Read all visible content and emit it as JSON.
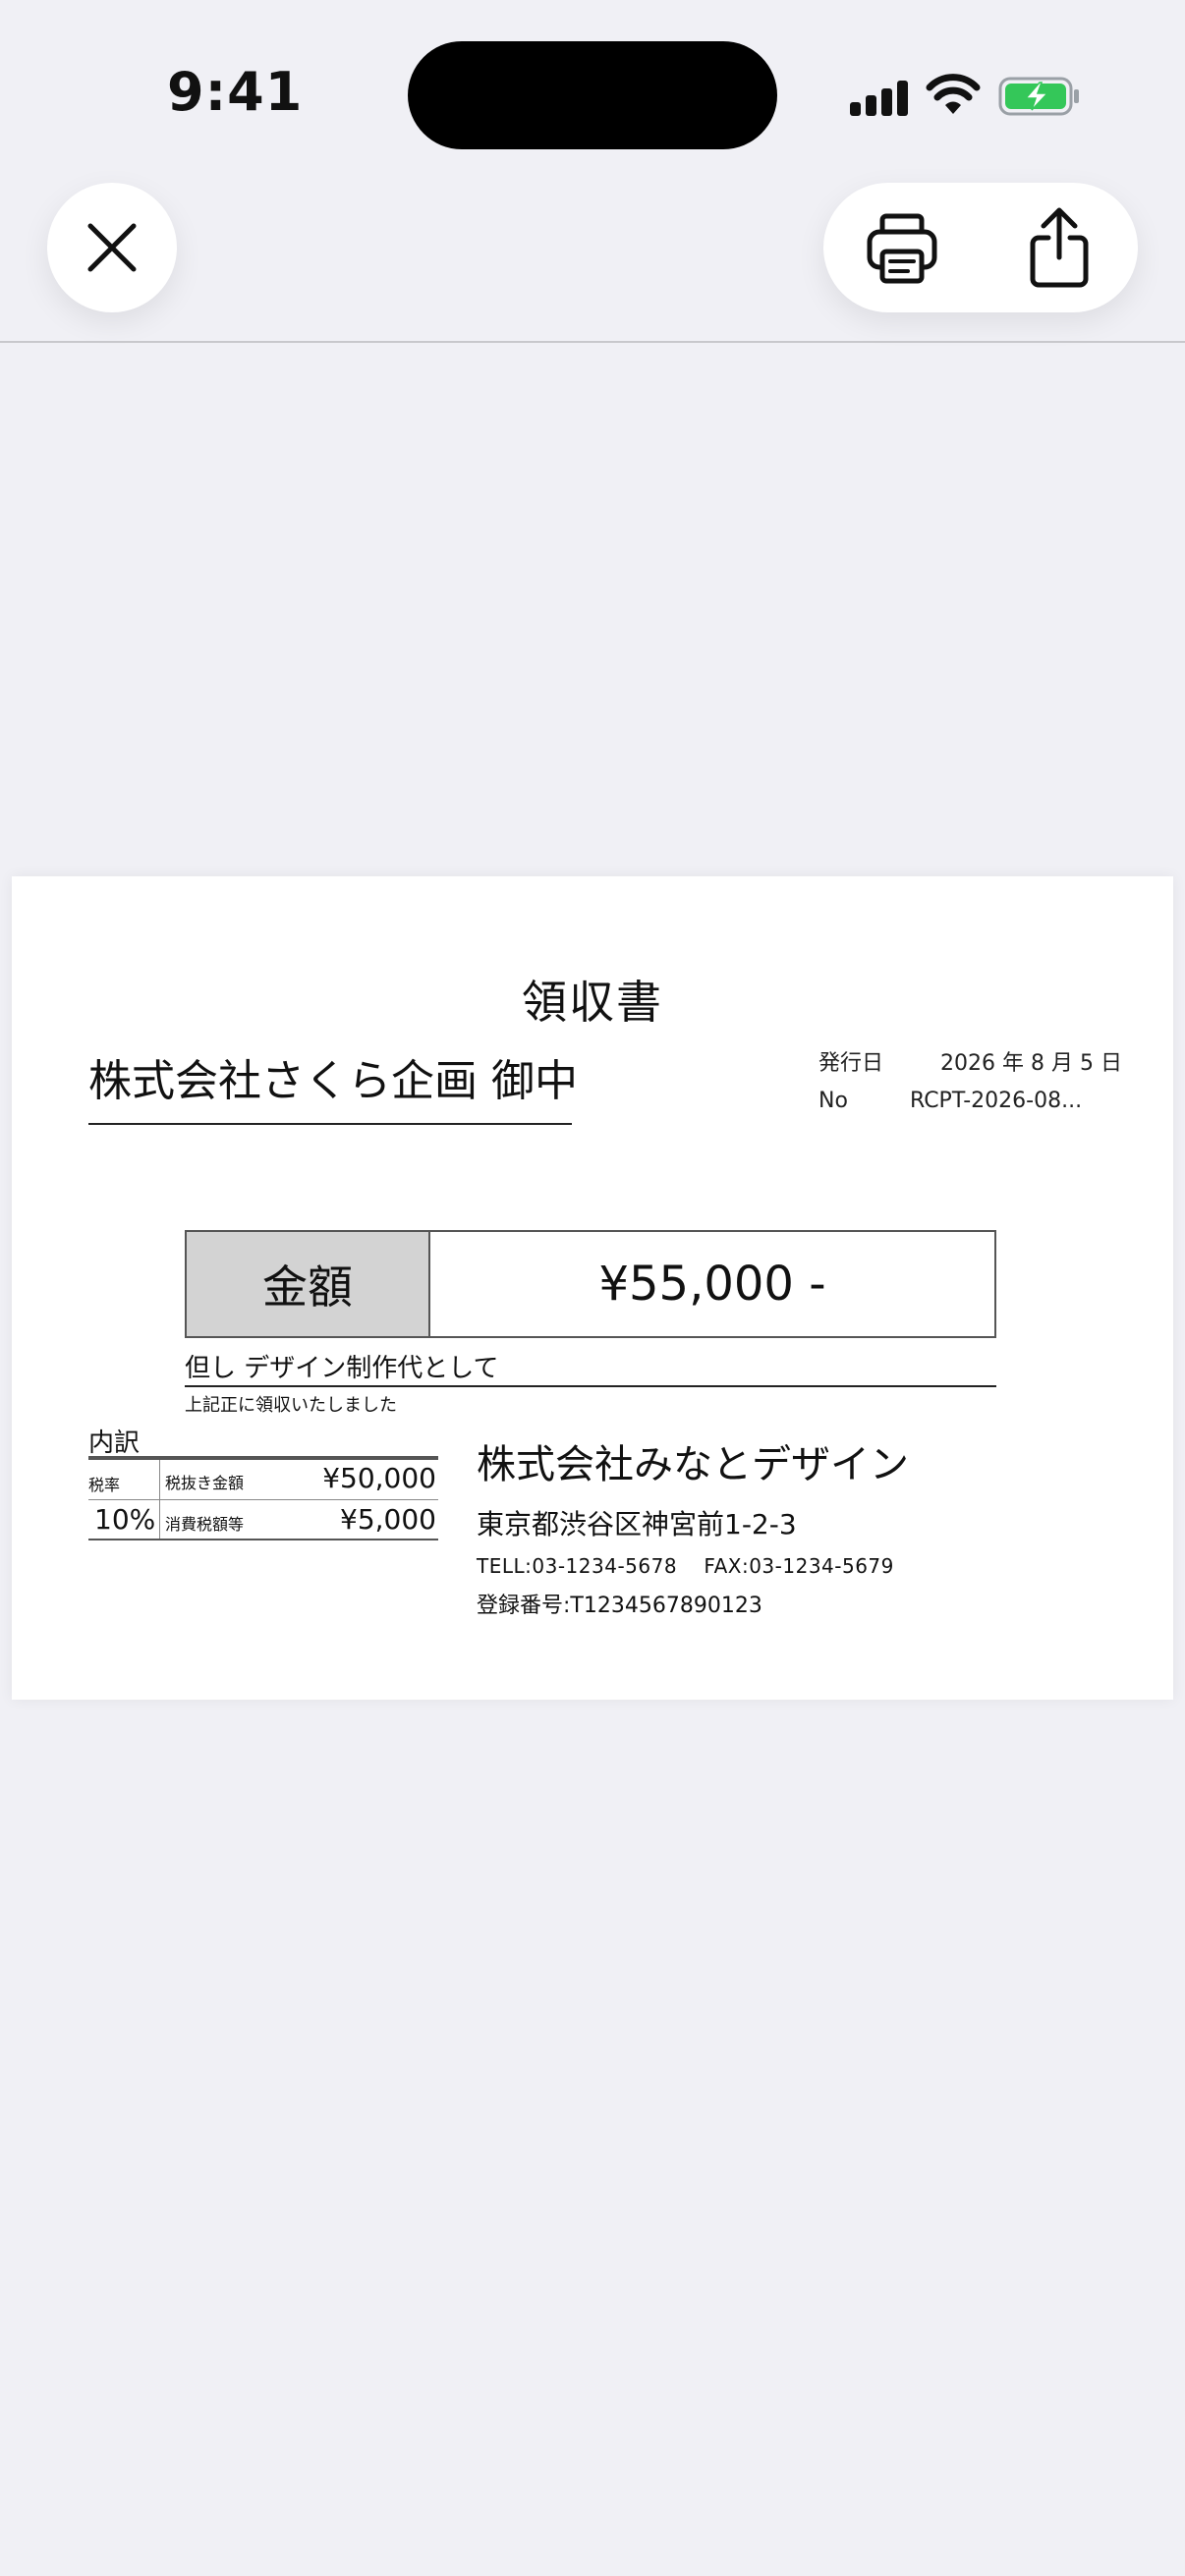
{
  "status_bar": {
    "time": "9:41"
  },
  "toolbar": {
    "close_icon": "close-icon",
    "print_icon": "print-icon",
    "share_icon": "share-icon"
  },
  "receipt": {
    "title": "領収書",
    "recipient": "株式会社さくら企画 御中",
    "issue_date_label": "発行日",
    "issue_date": "2026 年 8 月 5 日",
    "number_label": "No",
    "number": "RCPT-2026-08...",
    "amount_label": "金額",
    "amount": "¥55,000 -",
    "memo": "但し デザイン制作代として",
    "note": "上記正に領収いたしました",
    "breakdown": {
      "title": "内訳",
      "tax_rate_label": "税率",
      "tax_rate": "10%",
      "subtotal_label": "税抜き金額",
      "subtotal": "¥50,000",
      "tax_label": "消費税額等",
      "tax": "¥5,000"
    },
    "issuer": {
      "name": "株式会社みなとデザイン",
      "address": "東京都渋谷区神宮前1-2-3",
      "phone": "TELL:03-1234-5678　 FAX:03-1234-5679",
      "registration": "登録番号:T1234567890123"
    }
  },
  "colors": {
    "background": "#f0f0f5",
    "battery_green": "#34c759",
    "amount_label_bg": "#d3d3d3"
  }
}
